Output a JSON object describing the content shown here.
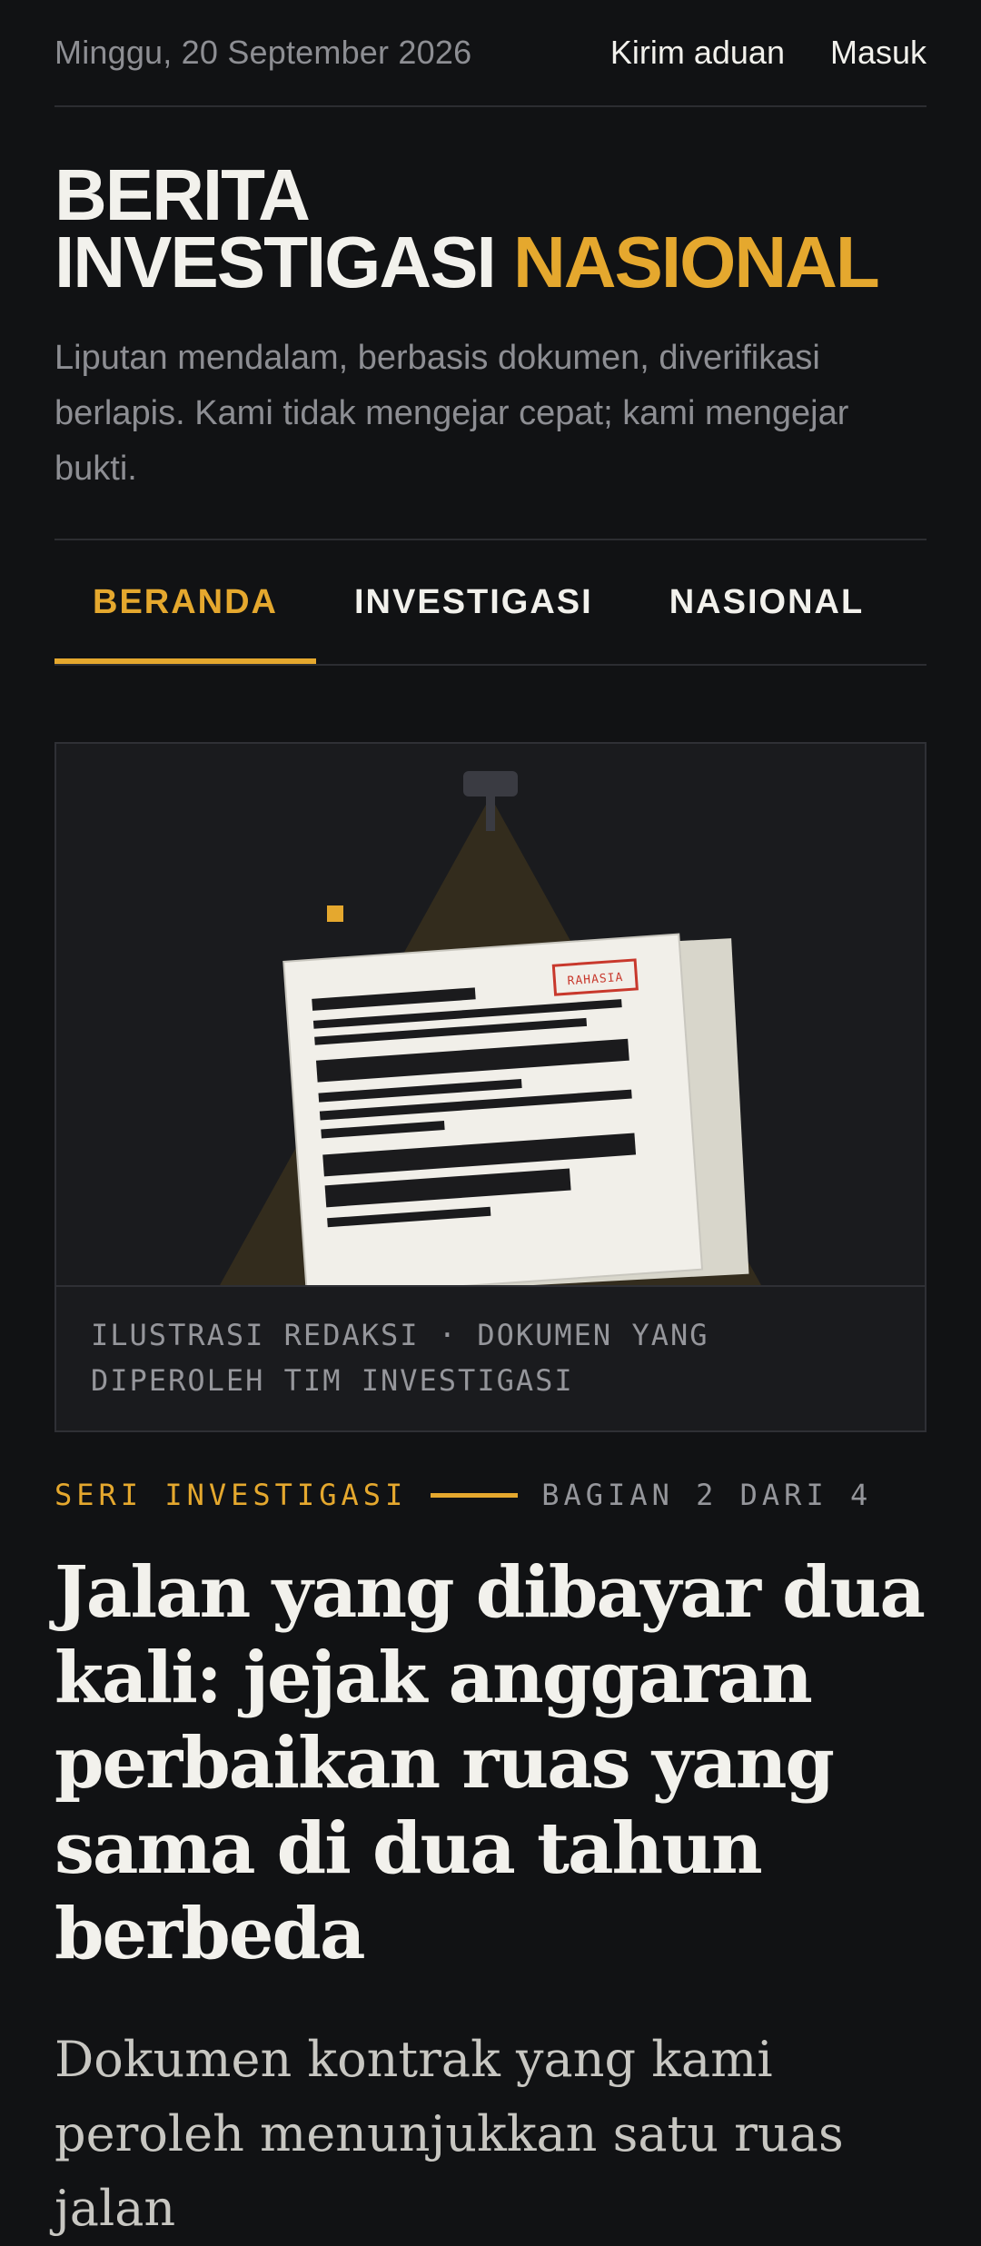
{
  "topbar": {
    "date": "Minggu, 20 September 2026",
    "links": {
      "complaint": "Kirim aduan",
      "login": "Masuk"
    }
  },
  "masthead": {
    "line1": "BERITA",
    "line2_main": "INVESTIGASI",
    "line2_accent": "NASIONAL",
    "tagline": "Liputan mendalam, berbasis dokumen, diverifikasi berlapis. Kami tidak mengejar cepat; kami mengejar bukti."
  },
  "tabs": [
    {
      "label": "BERANDA",
      "active": true
    },
    {
      "label": "INVESTIGASI",
      "active": false
    },
    {
      "label": "NASIONAL",
      "active": false
    }
  ],
  "hero": {
    "stamp": "RAHASIA",
    "caption": "ILUSTRASI REDAKSI · DOKUMEN YANG DIPEROLEH TIM INVESTIGASI"
  },
  "article": {
    "series": "SERI INVESTIGASI",
    "part": "BAGIAN 2 DARI 4",
    "headline": "Jalan yang dibayar dua kali: jejak anggaran perbaikan ruas yang sama di dua tahun berbeda",
    "dek": "Dokumen kontrak yang kami peroleh menunjukkan satu ruas jalan"
  },
  "colors": {
    "background": "#111214",
    "accent": "#e5a82e",
    "muted_text": "#8d8e93",
    "stamp_red": "#c8382c",
    "paper": "#f1efe9"
  }
}
